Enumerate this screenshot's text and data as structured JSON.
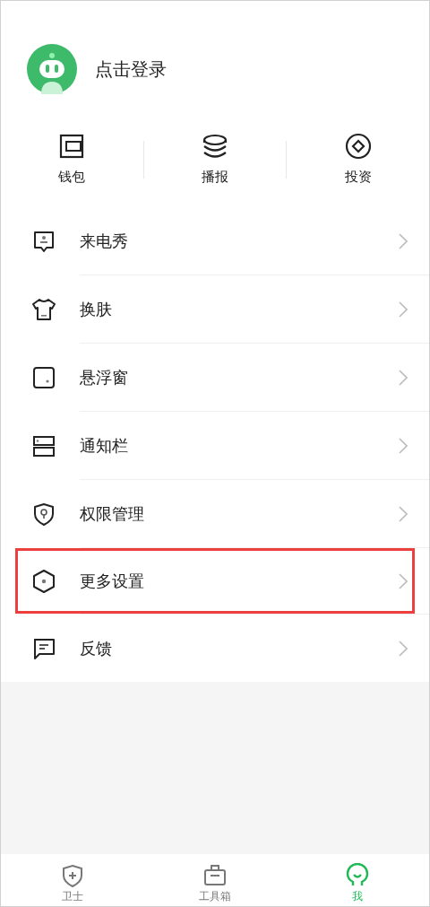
{
  "profile": {
    "login_label": "点击登录"
  },
  "quick_actions": [
    {
      "kind": "wallet",
      "label": "钱包"
    },
    {
      "kind": "stack",
      "label": "播报"
    },
    {
      "kind": "coin",
      "label": "投资"
    }
  ],
  "menu": [
    {
      "kind": "caller",
      "label": "来电秀",
      "highlighted": false
    },
    {
      "kind": "shirt",
      "label": "换肤",
      "highlighted": false
    },
    {
      "kind": "window",
      "label": "悬浮窗",
      "highlighted": false
    },
    {
      "kind": "bar",
      "label": "通知栏",
      "highlighted": false
    },
    {
      "kind": "shield",
      "label": "权限管理",
      "highlighted": false
    },
    {
      "kind": "hexagon",
      "label": "更多设置",
      "highlighted": true
    },
    {
      "kind": "chat",
      "label": "反馈",
      "highlighted": false
    }
  ],
  "tab_bar": [
    {
      "kind": "shield",
      "label": "卫士",
      "selected": false
    },
    {
      "kind": "toolbox",
      "label": "工具箱",
      "selected": false
    },
    {
      "kind": "me",
      "label": "我",
      "selected": true
    }
  ]
}
